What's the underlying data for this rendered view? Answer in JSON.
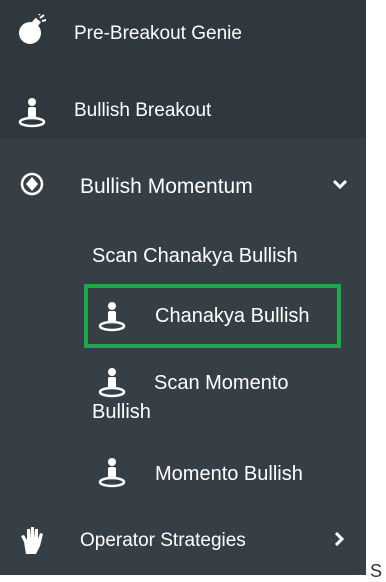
{
  "menu": {
    "items": [
      {
        "label": "Pre-Breakout Genie",
        "icon": "bomb-icon"
      },
      {
        "label": "Bullish Breakout",
        "icon": "person-target-icon"
      },
      {
        "label": "Bullish Momentum",
        "icon": "circle-target-icon",
        "expanded": true
      },
      {
        "label": "Operator Strategies",
        "icon": "hand-icon"
      }
    ],
    "submenu": [
      {
        "label": "Scan Chanakya Bullish",
        "icon": ""
      },
      {
        "label": "Chanakya Bullish",
        "icon": "person-target-icon",
        "active": true
      },
      {
        "label_line1": "Scan Momento",
        "label_line2": "Bullish",
        "icon": "person-target-icon"
      },
      {
        "label": "Momento Bullish",
        "icon": "person-target-icon"
      }
    ]
  },
  "trailing_text": "S",
  "colors": {
    "sidebar_bg": "#2f383e",
    "active_bg": "#373f46",
    "highlight": "#1fa84a",
    "text": "#ffffff"
  }
}
